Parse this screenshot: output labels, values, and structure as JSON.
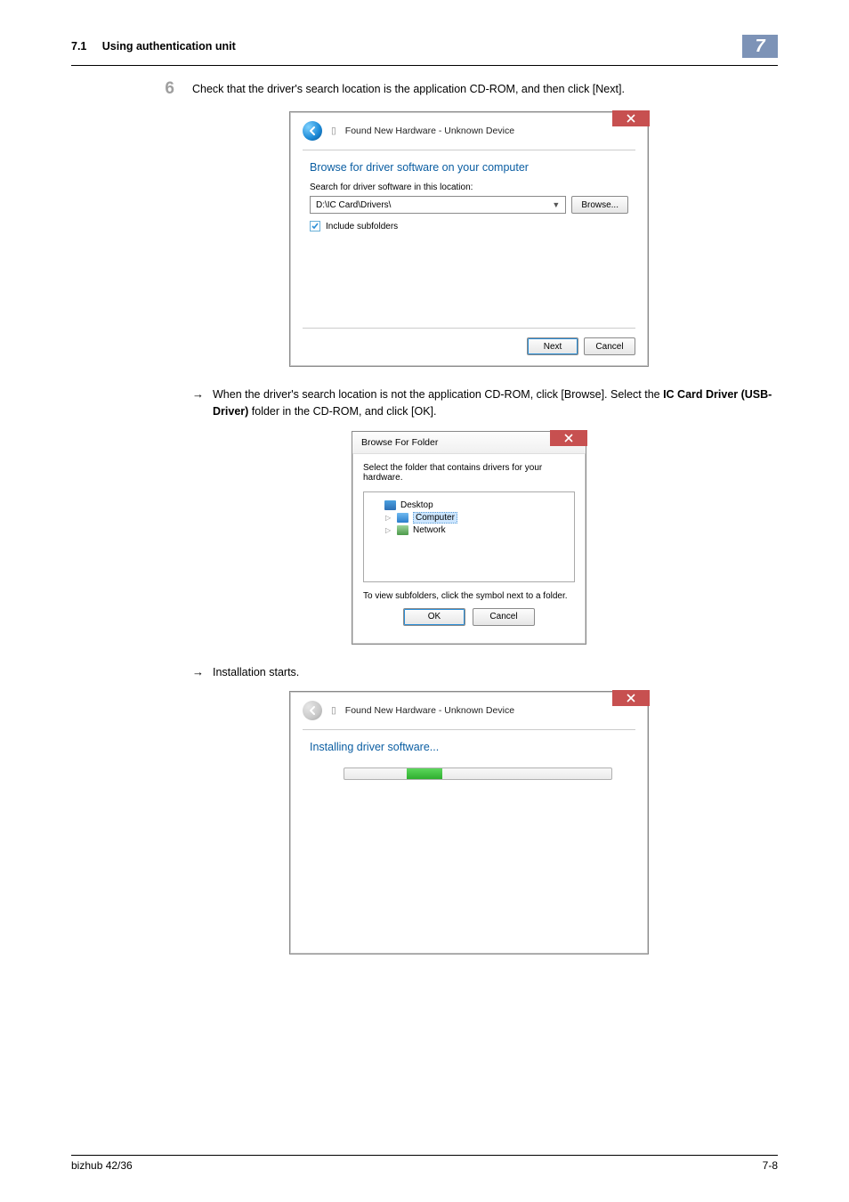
{
  "page": {
    "section_num": "7.1",
    "section_title": "Using authentication unit",
    "chapter_num": "7",
    "footer_left": "bizhub 42/36",
    "footer_right": "7-8"
  },
  "step6": {
    "num": "6",
    "text": "Check that the driver's search location is the application CD-ROM, and then click [Next]."
  },
  "dlg1": {
    "title": "Found New Hardware - Unknown Device",
    "heading": "Browse for driver software on your computer",
    "search_label": "Search for driver software in this location:",
    "path": "D:\\IC Card\\Drivers\\",
    "browse_btn": "Browse...",
    "include_subfolders": "Include subfolders",
    "next_btn": "Next",
    "cancel_btn": "Cancel"
  },
  "arrow1": {
    "text_a": "When the driver's search location is not the application CD-ROM, click [Browse]. Select the ",
    "text_b": "IC Card Driver (USB-Driver)",
    "text_c": " folder in the CD-ROM, and click [OK]."
  },
  "dlg2": {
    "title": "Browse For Folder",
    "msg": "Select the folder that contains drivers for your hardware.",
    "desktop": "Desktop",
    "computer": "Computer",
    "network": "Network",
    "hint": "To view subfolders, click the symbol next to a folder.",
    "ok_btn": "OK",
    "cancel_btn": "Cancel"
  },
  "arrow2": {
    "text": "Installation starts."
  },
  "dlg3": {
    "title": "Found New Hardware - Unknown Device",
    "heading": "Installing driver software..."
  }
}
